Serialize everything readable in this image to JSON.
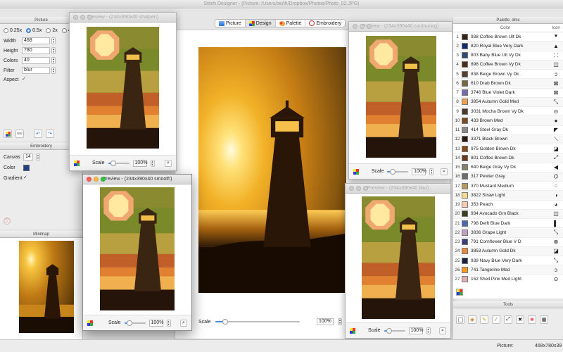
{
  "app": {
    "window_title": "Stitch Designer - (Picture: /Users/se/th/Dropbox/Photos/Photo_02.JPG)"
  },
  "toolbar": {
    "tabs": [
      {
        "label": "Picture",
        "icon": "picture-icon"
      },
      {
        "label": "Design",
        "icon": "design-icon"
      },
      {
        "label": "Palette",
        "icon": "palette-icon"
      },
      {
        "label": "Embroidery",
        "icon": "embroidery-icon"
      }
    ]
  },
  "picture_panel": {
    "title": "Picture",
    "scale_options": [
      "0.25x",
      "0.5x",
      "2x",
      "4"
    ],
    "width_label": "Width",
    "width_value": "468",
    "height_label": "Height",
    "height_value": "780",
    "colors_label": "Colors",
    "colors_value": "40",
    "filter_label": "Filter",
    "filter_value": "blur",
    "aspect_label": "Aspect",
    "aspect_checked": "✓"
  },
  "embroidery_panel": {
    "title": "Embroidery",
    "canvas_label": "Canvas",
    "canvas_value": "14",
    "color_label": "Color",
    "color_swatch": "#1f3f86",
    "gradient_label": "Gradient",
    "gradient_checked": "✓"
  },
  "minimap_panel": {
    "title": "Minimap"
  },
  "main_view": {
    "scale_label": "Scale",
    "scale_value": "100%",
    "scale_fraction": 0.12
  },
  "previews": {
    "sharpen": {
      "title": "Preview - (234x390x40 sharpen)",
      "scale_label": "Scale",
      "scale_value": "100%",
      "scale_fraction": 0.25
    },
    "contouring": {
      "title": "Preview - (234x390x40 contouring)",
      "scale_label": "Scale",
      "scale_value": "100%",
      "scale_fraction": 0.25
    },
    "smooth": {
      "title": "Preview - (234x390x40 smooth)",
      "scale_label": "Scale",
      "scale_value": "100%",
      "scale_fraction": 0.25
    },
    "blur": {
      "title": "Preview - (234x390x40 blur)",
      "scale_label": "Scale",
      "scale_value": "100%",
      "scale_fraction": 0.25
    }
  },
  "palette_panel": {
    "title": "Palette: dmc",
    "col_color": "Color",
    "col_icon": "Icon",
    "rows": [
      {
        "n": "1",
        "name": "938 Coffee Brown Ult Dk",
        "swatch": "#3a2214",
        "icon": "⯆"
      },
      {
        "n": "2",
        "name": "820 Royal Blue Very Dark",
        "swatch": "#0e2a6e",
        "icon": "▲"
      },
      {
        "n": "3",
        "name": "803 Baby Blue Ult Vy Dk",
        "swatch": "#2c4a74",
        "icon": "⸬"
      },
      {
        "n": "4",
        "name": "898 Coffee Brown Vy Dk",
        "swatch": "#4b2e1c",
        "icon": "◫"
      },
      {
        "n": "5",
        "name": "838 Beige Brown Vy Dk",
        "swatch": "#5a3f2c",
        "icon": "ↄ"
      },
      {
        "n": "6",
        "name": "610 Drab Brown Dk",
        "swatch": "#7a6640",
        "icon": "⊠"
      },
      {
        "n": "7",
        "name": "3746 Blue Violet Dark",
        "swatch": "#7868b0",
        "icon": "⊠"
      },
      {
        "n": "8",
        "name": "3854 Autumn Gold Med",
        "swatch": "#f0a050",
        "icon": "⤡"
      },
      {
        "n": "9",
        "name": "3031 Mocha Brown Vy Dk",
        "swatch": "#4b3c2a",
        "icon": "⊙"
      },
      {
        "n": "10",
        "name": "433 Brown Med",
        "swatch": "#7a4a22",
        "icon": "●"
      },
      {
        "n": "11",
        "name": "414 Steel Gray Dk",
        "swatch": "#8a8a8a",
        "icon": "◤"
      },
      {
        "n": "12",
        "name": "3371 Black Brown",
        "swatch": "#2a1a10",
        "icon": "⟍"
      },
      {
        "n": "13",
        "name": "975 Golden Brown Dk",
        "swatch": "#8a4a18",
        "icon": "◪"
      },
      {
        "n": "14",
        "name": "801 Coffee Brown Dk",
        "swatch": "#6a3a1c",
        "icon": "⤢"
      },
      {
        "n": "15",
        "name": "640 Beige Gray Vy Dk",
        "swatch": "#8a8268",
        "icon": "◀"
      },
      {
        "n": "16",
        "name": "317 Pewter Gray",
        "swatch": "#6c6c6c",
        "icon": "⌬"
      },
      {
        "n": "17",
        "name": "370 Mustard Medium",
        "swatch": "#b89a5a",
        "icon": "⁘"
      },
      {
        "n": "18",
        "name": "3822 Straw Light",
        "swatch": "#f6dc8a",
        "icon": "◑"
      },
      {
        "n": "19",
        "name": "353 Peach",
        "swatch": "#fccab0",
        "icon": "◕"
      },
      {
        "n": "20",
        "name": "934 Avocado Grn Black",
        "swatch": "#3a3e22",
        "icon": "◫"
      },
      {
        "n": "21",
        "name": "798 Delft Blue Dark",
        "swatch": "#4a6ab0",
        "icon": "▌"
      },
      {
        "n": "22",
        "name": "3836 Grape Light",
        "swatch": "#c0a0c8",
        "icon": "⤡"
      },
      {
        "n": "23",
        "name": "791 Cornflower Blue V D",
        "swatch": "#3a3e78",
        "icon": "⊗"
      },
      {
        "n": "24",
        "name": "3853 Autumn Gold Dk",
        "swatch": "#e88a3a",
        "icon": "◪"
      },
      {
        "n": "25",
        "name": "939 Navy Blue Very Dark",
        "swatch": "#1c2040",
        "icon": "⤡"
      },
      {
        "n": "26",
        "name": "741 Tangerine Med",
        "swatch": "#ff9a20",
        "icon": "ↄ"
      },
      {
        "n": "27",
        "name": "152 Shell Pink Med Light",
        "swatch": "#e0b0b0",
        "icon": "⊙"
      }
    ]
  },
  "tools_panel": {
    "title": "Tools",
    "tools": [
      "color-picker-icon",
      "fill-icon",
      "pencil-icon",
      "line-icon",
      "wand-icon",
      "cross-icon",
      "palette-tool-icon",
      "grid-icon"
    ],
    "status_label": "Picture:",
    "status_value": "468x780x39"
  }
}
